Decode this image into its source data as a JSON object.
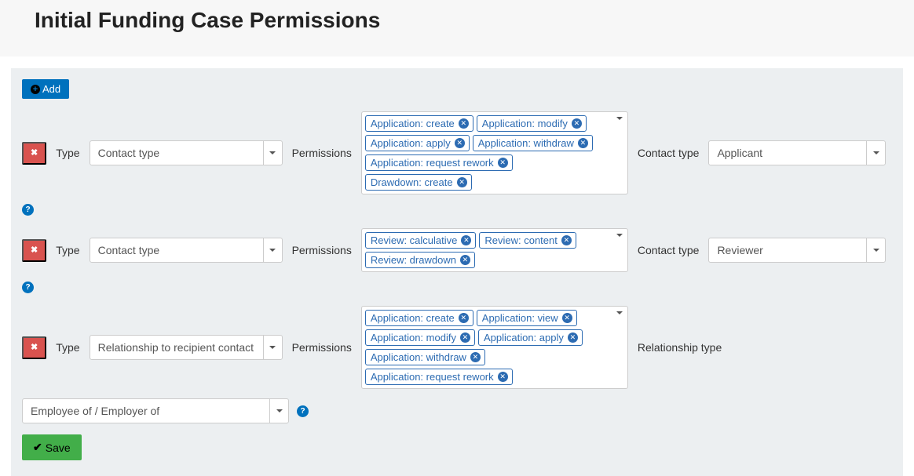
{
  "header": {
    "title": "Initial Funding Case Permissions"
  },
  "buttons": {
    "add": "Add",
    "save": "Save"
  },
  "labels": {
    "type": "Type",
    "permissions": "Permissions",
    "contact_type": "Contact type",
    "relationship_type": "Relationship type"
  },
  "type_options": {
    "contact_type": "Contact type",
    "relationship": "Relationship to recipient contact"
  },
  "rows": [
    {
      "type": "contact_type",
      "permissions": [
        "Application: create",
        "Application: modify",
        "Application: apply",
        "Application: withdraw",
        "Application: request rework",
        "Drawdown: create"
      ],
      "contact_type_value": "Applicant"
    },
    {
      "type": "contact_type",
      "permissions": [
        "Review: calculative",
        "Review: content",
        "Review: drawdown"
      ],
      "contact_type_value": "Reviewer"
    },
    {
      "type": "relationship",
      "permissions": [
        "Application: create",
        "Application: view",
        "Application: modify",
        "Application: apply",
        "Application: withdraw",
        "Application: request rework"
      ],
      "relationship_value": "Employee of / Employer of"
    }
  ]
}
